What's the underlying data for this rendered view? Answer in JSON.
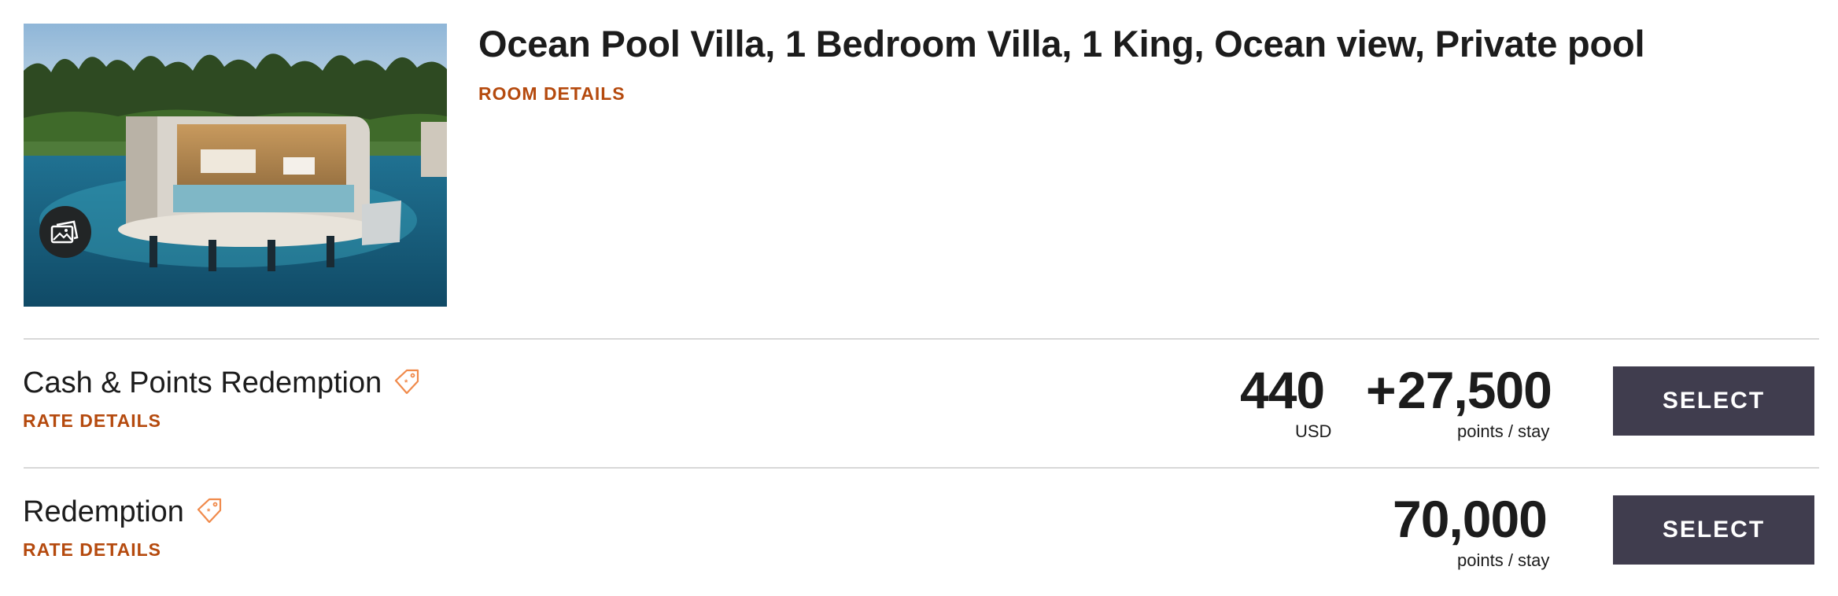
{
  "room": {
    "title": "Ocean Pool Villa, 1 Bedroom Villa, 1 King, Ocean view, Private pool",
    "details_link": "ROOM DETAILS",
    "photo_alt": "Overwater villa with private pool",
    "gallery_icon": "photo-gallery-icon"
  },
  "rates": [
    {
      "name": "Cash & Points Redemption",
      "details_link": "RATE DETAILS",
      "tag_icon": "price-tag-icon",
      "cash_amount": "440",
      "cash_unit": "USD",
      "plus": "+",
      "points_amount": "27,500",
      "points_unit": "points / stay",
      "select_label": "SELECT"
    },
    {
      "name": "Redemption",
      "details_link": "RATE DETAILS",
      "tag_icon": "price-tag-icon",
      "points_amount": "70,000",
      "points_unit": "points / stay",
      "select_label": "SELECT"
    }
  ],
  "colors": {
    "accent_orange": "#b54a0e",
    "tag_icon_orange": "#f08a4b",
    "select_button_bg": "#403d4e",
    "divider": "#d8d8d8",
    "text": "#1c1c1c"
  }
}
